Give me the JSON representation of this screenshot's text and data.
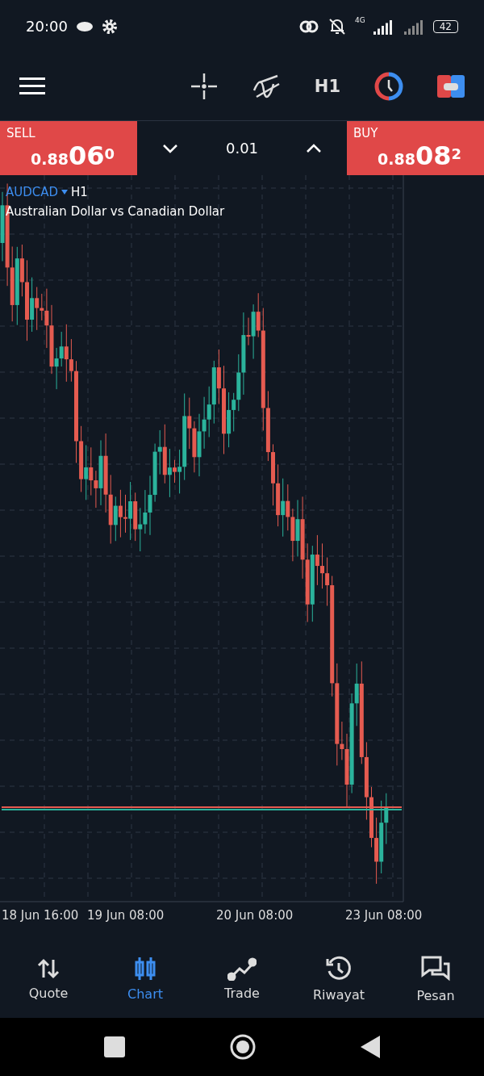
{
  "status_bar": {
    "time": "20:00",
    "network": "4G",
    "battery": "42"
  },
  "toolbar": {
    "timeframe": "H1"
  },
  "trade_panel": {
    "sell": {
      "label": "SELL",
      "price_main": "0.88",
      "price_big": "06",
      "price_sup": "0"
    },
    "volume": "0.01",
    "buy": {
      "label": "BUY",
      "price_main": "0.88",
      "price_big": "08",
      "price_sup": "2"
    }
  },
  "chart": {
    "symbol": "AUDCAD",
    "timeframe": "H1",
    "description": "Australian Dollar vs Canadian Dollar",
    "x_labels": [
      "18 Jun 16:00",
      "19 Jun 08:00",
      "20 Jun 08:00",
      "23 Jun 08:00"
    ]
  },
  "bottom_nav": [
    {
      "label": "Quote",
      "kind": "quote",
      "selected": false
    },
    {
      "label": "Chart",
      "kind": "chart",
      "selected": true
    },
    {
      "label": "Trade",
      "kind": "trade",
      "selected": false
    },
    {
      "label": "Riwayat",
      "kind": "history",
      "selected": false
    },
    {
      "label": "Pesan",
      "kind": "messages",
      "selected": false
    }
  ]
}
